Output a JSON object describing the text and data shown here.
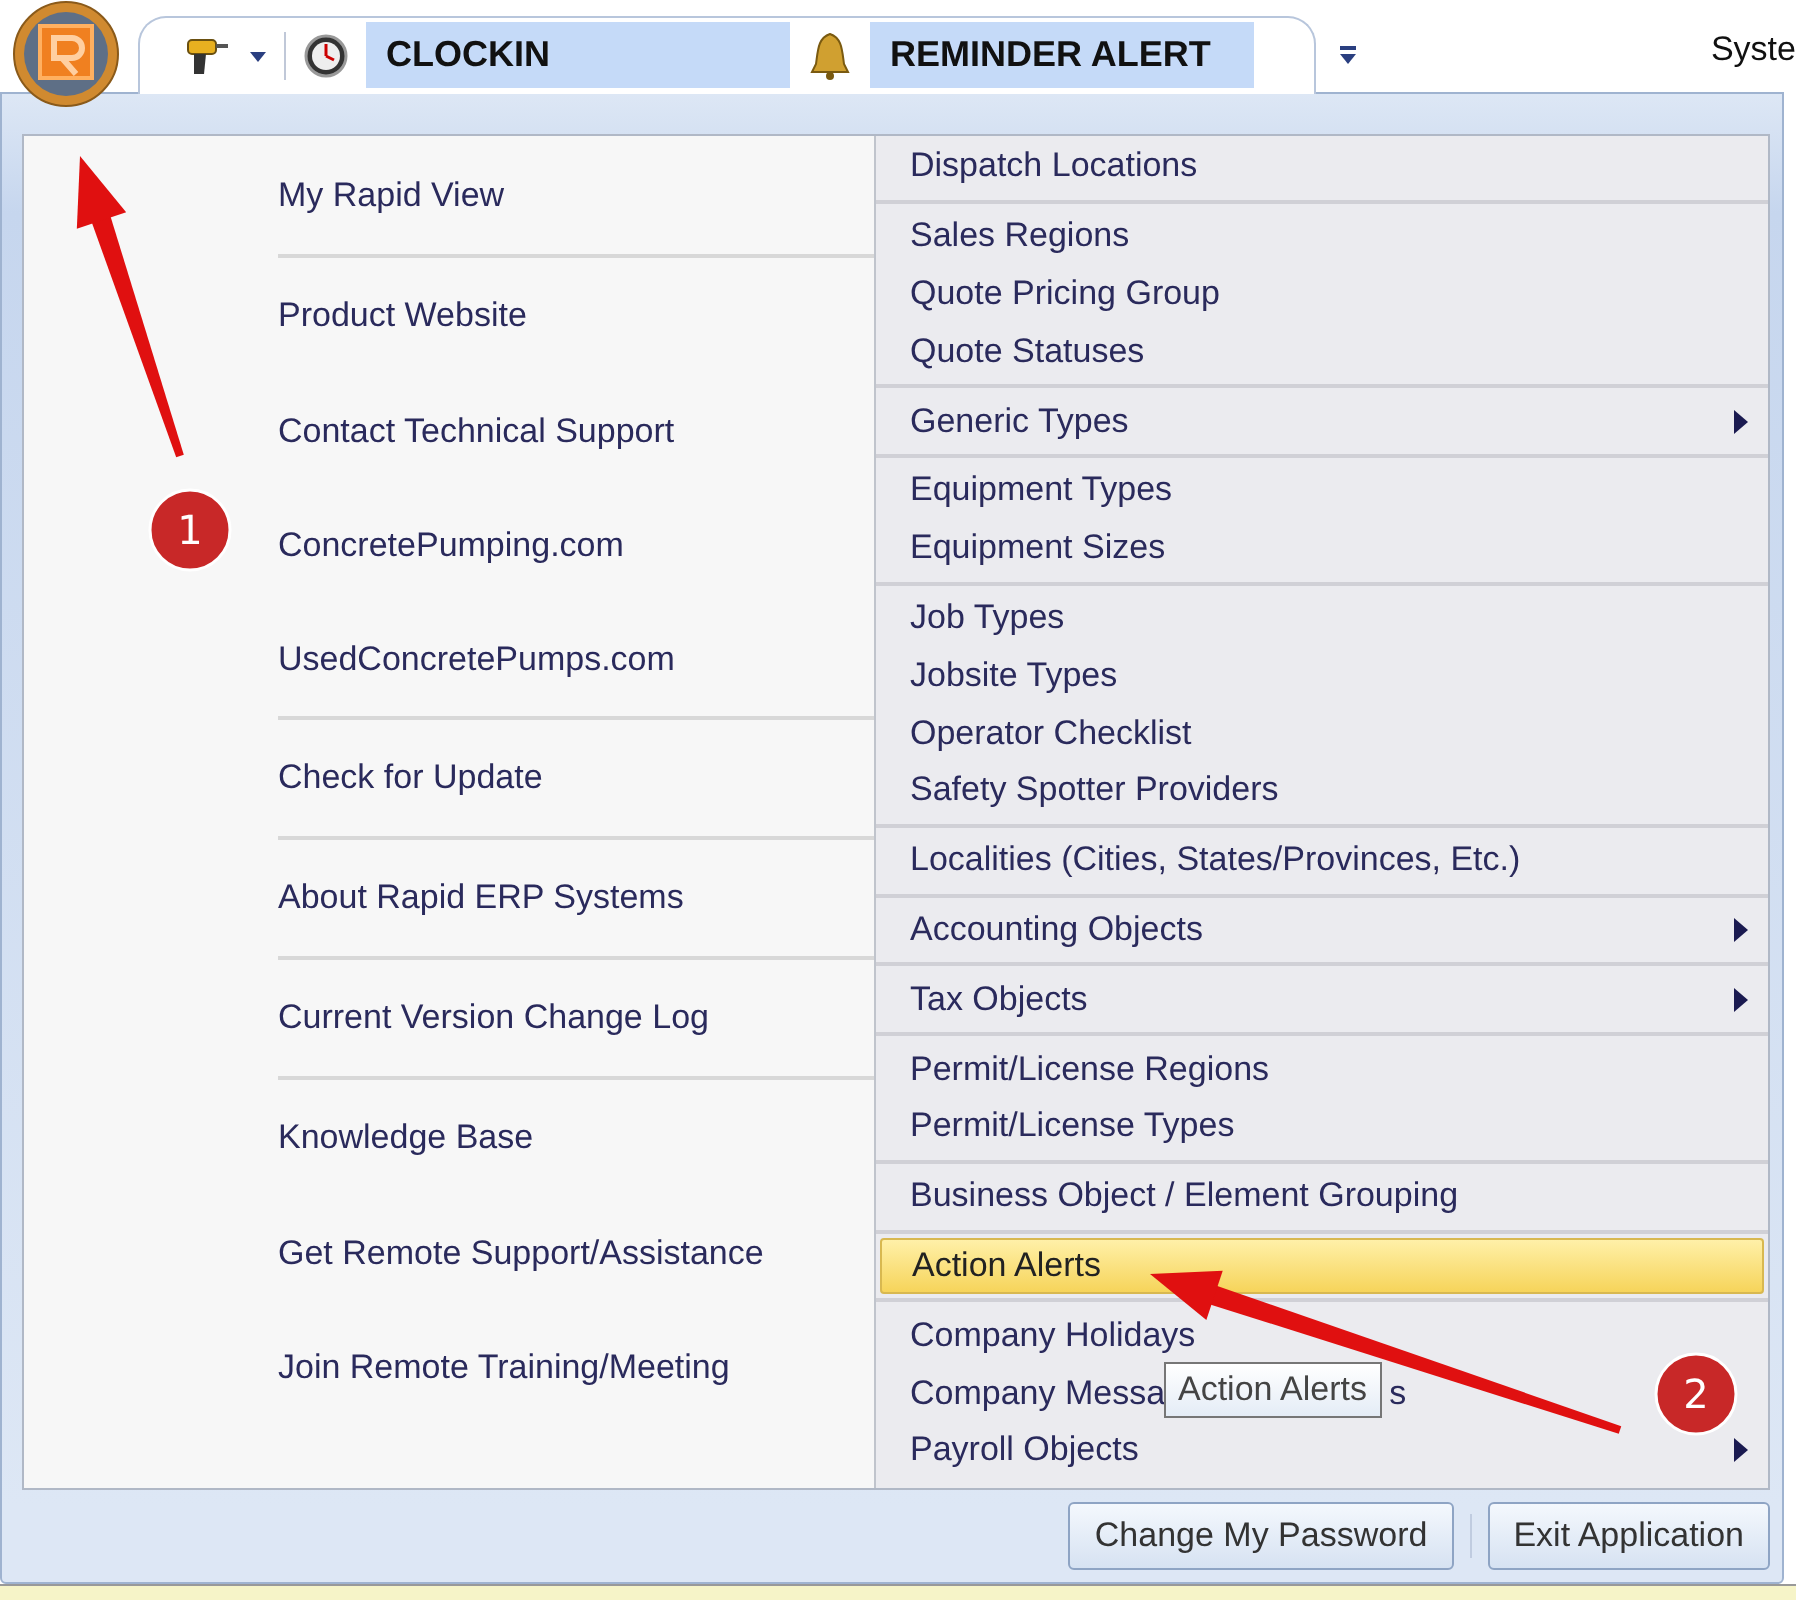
{
  "toolbar": {
    "clock_in": "CLOCKIN",
    "reminder": "REMINDER ALERT",
    "right_text": "Syste"
  },
  "left_menu": {
    "groups": [
      [
        {
          "label": "My Rapid View"
        }
      ],
      [
        {
          "label": "Product Website"
        },
        {
          "label": "Contact Technical Support"
        },
        {
          "label": "ConcretePumping.com"
        },
        {
          "label": "UsedConcretePumps.com"
        }
      ],
      [
        {
          "label": "Check for Update"
        }
      ],
      [
        {
          "label": "About Rapid ERP Systems"
        }
      ],
      [
        {
          "label": "Current Version Change Log"
        }
      ],
      [
        {
          "label": "Knowledge Base"
        },
        {
          "label": "Get Remote Support/Assistance"
        },
        {
          "label": "Join Remote Training/Meeting"
        }
      ]
    ]
  },
  "right_menu": {
    "groups": [
      [
        {
          "label": "Dispatch Locations",
          "submenu": false,
          "selected": false
        }
      ],
      [
        {
          "label": "Sales Regions",
          "submenu": false,
          "selected": false
        },
        {
          "label": "Quote Pricing Group",
          "submenu": false,
          "selected": false
        },
        {
          "label": "Quote Statuses",
          "submenu": false,
          "selected": false
        }
      ],
      [
        {
          "label": "Generic Types",
          "submenu": true,
          "selected": false
        }
      ],
      [
        {
          "label": "Equipment Types",
          "submenu": false,
          "selected": false
        },
        {
          "label": "Equipment Sizes",
          "submenu": false,
          "selected": false
        }
      ],
      [
        {
          "label": "Job Types",
          "submenu": false,
          "selected": false
        },
        {
          "label": "Jobsite Types",
          "submenu": false,
          "selected": false
        },
        {
          "label": "Operator Checklist",
          "submenu": false,
          "selected": false
        },
        {
          "label": "Safety Spotter Providers",
          "submenu": false,
          "selected": false
        }
      ],
      [
        {
          "label": "Localities (Cities, States/Provinces, Etc.)",
          "submenu": false,
          "selected": false
        }
      ],
      [
        {
          "label": "Accounting Objects",
          "submenu": true,
          "selected": false
        }
      ],
      [
        {
          "label": "Tax Objects",
          "submenu": true,
          "selected": false
        }
      ],
      [
        {
          "label": "Permit/License Regions",
          "submenu": false,
          "selected": false
        },
        {
          "label": "Permit/License Types",
          "submenu": false,
          "selected": false
        }
      ],
      [
        {
          "label": "Business Object / Element Grouping",
          "submenu": false,
          "selected": false
        }
      ],
      [
        {
          "label": "Action Alerts",
          "submenu": false,
          "selected": true
        }
      ],
      [
        {
          "label": "Company Holidays",
          "submenu": false,
          "selected": false
        },
        {
          "label": "Company Messa",
          "tail": "s",
          "submenu": false,
          "selected": false
        },
        {
          "label": "Payroll Objects",
          "submenu": true,
          "selected": false
        }
      ]
    ]
  },
  "tooltip": "Action Alerts",
  "buttons": [
    "Change My Password",
    "Exit Application"
  ],
  "annotations": [
    {
      "label": "1"
    },
    {
      "label": "2"
    }
  ]
}
